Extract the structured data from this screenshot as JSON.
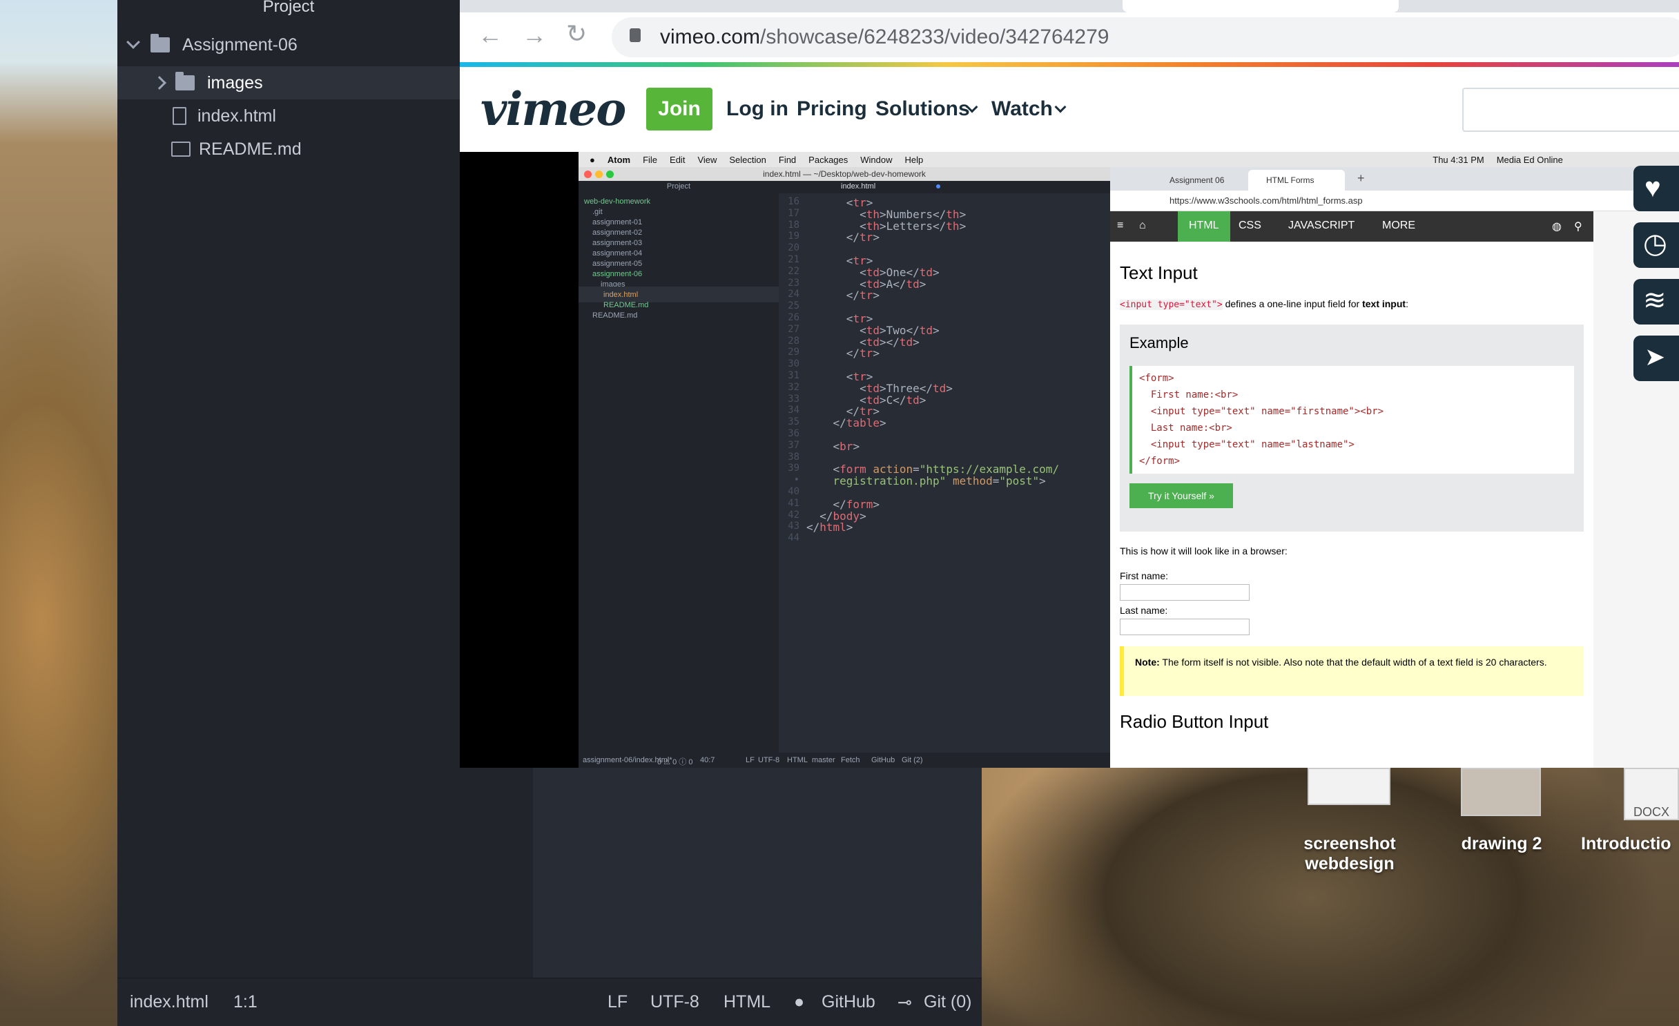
{
  "atom_window": {
    "project_title": "Project",
    "tree": [
      {
        "label": "Assignment-06",
        "kind": "folder",
        "expanded": true
      },
      {
        "label": "images",
        "kind": "folder",
        "expanded": false
      },
      {
        "label": "index.html",
        "kind": "file"
      },
      {
        "label": "README.md",
        "kind": "file"
      }
    ],
    "status": {
      "file": "index.html",
      "cursor": "1:1",
      "eol": "LF",
      "encoding": "UTF-8",
      "grammar": "HTML",
      "github": "GitHub",
      "git": "Git (0)"
    }
  },
  "browser": {
    "url_host": "vimeo.com",
    "url_path": "/showcase/6248233/video/342764279"
  },
  "vimeo": {
    "logo": "vimeo",
    "join": "Join",
    "login": "Log in",
    "pricing": "Pricing",
    "solutions": "Solutions",
    "watch": "Watch"
  },
  "inner_screen": {
    "menubar": [
      "Atom",
      "File",
      "Edit",
      "View",
      "Selection",
      "Find",
      "Packages",
      "Window",
      "Help"
    ],
    "clock": "Thu 4:31 PM",
    "account": "Media Ed Online",
    "atom_title": "index.html — ~/Desktop/web-dev-homework",
    "tree_header": "Project",
    "tab": "index.html",
    "tree": [
      "web-dev-homework",
      ".git",
      "assignment-01",
      "assignment-02",
      "assignment-03",
      "assignment-04",
      "assignment-05",
      "assignment-06",
      "images",
      "index.html",
      "README.md",
      "README.md"
    ],
    "code_lines": [
      {
        "n": "16",
        "parts": [
          [
            "pn",
            "      <"
          ],
          [
            "tg",
            "tr"
          ],
          [
            "pn",
            ">"
          ]
        ]
      },
      {
        "n": "17",
        "parts": [
          [
            "pn",
            "        <"
          ],
          [
            "tg",
            "th"
          ],
          [
            "pn",
            ">Numbers</"
          ],
          [
            "tg",
            "th"
          ],
          [
            "pn",
            ">"
          ]
        ]
      },
      {
        "n": "18",
        "parts": [
          [
            "pn",
            "        <"
          ],
          [
            "tg",
            "th"
          ],
          [
            "pn",
            ">Letters</"
          ],
          [
            "tg",
            "th"
          ],
          [
            "pn",
            ">"
          ]
        ]
      },
      {
        "n": "19",
        "parts": [
          [
            "pn",
            "      </"
          ],
          [
            "tg",
            "tr"
          ],
          [
            "pn",
            ">"
          ]
        ]
      },
      {
        "n": "20",
        "parts": []
      },
      {
        "n": "21",
        "parts": [
          [
            "pn",
            "      <"
          ],
          [
            "tg",
            "tr"
          ],
          [
            "pn",
            ">"
          ]
        ]
      },
      {
        "n": "22",
        "parts": [
          [
            "pn",
            "        <"
          ],
          [
            "tg",
            "td"
          ],
          [
            "pn",
            ">One</"
          ],
          [
            "tg",
            "td"
          ],
          [
            "pn",
            ">"
          ]
        ]
      },
      {
        "n": "23",
        "parts": [
          [
            "pn",
            "        <"
          ],
          [
            "tg",
            "td"
          ],
          [
            "pn",
            ">A</"
          ],
          [
            "tg",
            "td"
          ],
          [
            "pn",
            ">"
          ]
        ]
      },
      {
        "n": "24",
        "parts": [
          [
            "pn",
            "      </"
          ],
          [
            "tg",
            "tr"
          ],
          [
            "pn",
            ">"
          ]
        ]
      },
      {
        "n": "25",
        "parts": []
      },
      {
        "n": "26",
        "parts": [
          [
            "pn",
            "      <"
          ],
          [
            "tg",
            "tr"
          ],
          [
            "pn",
            ">"
          ]
        ]
      },
      {
        "n": "27",
        "parts": [
          [
            "pn",
            "        <"
          ],
          [
            "tg",
            "td"
          ],
          [
            "pn",
            ">Two</"
          ],
          [
            "tg",
            "td"
          ],
          [
            "pn",
            ">"
          ]
        ]
      },
      {
        "n": "28",
        "parts": [
          [
            "pn",
            "        <"
          ],
          [
            "tg",
            "td"
          ],
          [
            "pn",
            "></"
          ],
          [
            "tg",
            "td"
          ],
          [
            "pn",
            ">"
          ]
        ]
      },
      {
        "n": "29",
        "parts": [
          [
            "pn",
            "      </"
          ],
          [
            "tg",
            "tr"
          ],
          [
            "pn",
            ">"
          ]
        ]
      },
      {
        "n": "30",
        "parts": []
      },
      {
        "n": "31",
        "parts": [
          [
            "pn",
            "      <"
          ],
          [
            "tg",
            "tr"
          ],
          [
            "pn",
            ">"
          ]
        ]
      },
      {
        "n": "32",
        "parts": [
          [
            "pn",
            "        <"
          ],
          [
            "tg",
            "td"
          ],
          [
            "pn",
            ">Three</"
          ],
          [
            "tg",
            "td"
          ],
          [
            "pn",
            ">"
          ]
        ]
      },
      {
        "n": "33",
        "parts": [
          [
            "pn",
            "        <"
          ],
          [
            "tg",
            "td"
          ],
          [
            "pn",
            ">C</"
          ],
          [
            "tg",
            "td"
          ],
          [
            "pn",
            ">"
          ]
        ]
      },
      {
        "n": "34",
        "parts": [
          [
            "pn",
            "      </"
          ],
          [
            "tg",
            "tr"
          ],
          [
            "pn",
            ">"
          ]
        ]
      },
      {
        "n": "35",
        "parts": [
          [
            "pn",
            "    </"
          ],
          [
            "tg",
            "table"
          ],
          [
            "pn",
            ">"
          ]
        ]
      },
      {
        "n": "36",
        "parts": []
      },
      {
        "n": "37",
        "parts": [
          [
            "pn",
            "    <"
          ],
          [
            "tg",
            "br"
          ],
          [
            "pn",
            ">"
          ]
        ]
      },
      {
        "n": "38",
        "parts": []
      },
      {
        "n": "39",
        "parts": [
          [
            "pn",
            "    <"
          ],
          [
            "tg",
            "form"
          ],
          [
            "pn",
            " "
          ],
          [
            "at",
            "action"
          ],
          [
            "pn",
            "="
          ],
          [
            "st",
            "\"https://example.com/"
          ]
        ]
      },
      {
        "n": "•",
        "parts": [
          [
            "st",
            "    registration.php\""
          ],
          [
            "pn",
            " "
          ],
          [
            "at",
            "method"
          ],
          [
            "pn",
            "="
          ],
          [
            "st",
            "\"post\""
          ],
          [
            "pn",
            ">"
          ]
        ]
      },
      {
        "n": "40",
        "parts": []
      },
      {
        "n": "41",
        "parts": [
          [
            "pn",
            "    </"
          ],
          [
            "tg",
            "form"
          ],
          [
            "pn",
            ">"
          ]
        ]
      },
      {
        "n": "42",
        "parts": [
          [
            "pn",
            "  </"
          ],
          [
            "tg",
            "body"
          ],
          [
            "pn",
            ">"
          ]
        ]
      },
      {
        "n": "43",
        "parts": [
          [
            "pn",
            "</"
          ],
          [
            "tg",
            "html"
          ],
          [
            "pn",
            ">"
          ]
        ]
      },
      {
        "n": "44",
        "parts": []
      }
    ],
    "status": {
      "path": "assignment-06/index.html*",
      "diag": "0 ⚠ 0 ⓘ 0",
      "cursor": "40:7",
      "eol": "LF",
      "enc": "UTF-8",
      "grammar": "HTML",
      "branch": "master",
      "fetch": "Fetch",
      "github": "GitHub",
      "git": "Git (2)"
    },
    "chrome": {
      "tab1": "Assignment 06",
      "tab2": "HTML Forms",
      "url": "https://www.w3schools.com/html/html_forms.asp",
      "nav": [
        "HTML",
        "CSS",
        "JAVASCRIPT",
        "MORE"
      ],
      "heading": "Text Input",
      "intro_code": "<input type=\"text\">",
      "intro_rest": "defines a one-line input field for",
      "intro_bold": "text input",
      "example_title": "Example",
      "code": [
        "<form>",
        "  First name:<br>",
        "  <input type=\"text\" name=\"firstname\"><br>",
        "  Last name:<br>",
        "  <input type=\"text\" name=\"lastname\">",
        "</form>"
      ],
      "try_button": "Try it Yourself »",
      "browser_text": "This is how it will look like in a browser:",
      "first_label": "First name:",
      "last_label": "Last name:",
      "note_bold": "Note:",
      "note_text": "The form itself is not visible. Also note that the default width of a text field is 20 characters.",
      "next_heading": "Radio Button Input"
    }
  },
  "desktop_icons": [
    {
      "label_line1": "screenshot",
      "label_line2": "webdesign"
    },
    {
      "label_line1": "drawing 2",
      "label_line2": ""
    },
    {
      "label_line1": "Introductio",
      "label_line2": ""
    }
  ],
  "docx_badge": "DOCX"
}
